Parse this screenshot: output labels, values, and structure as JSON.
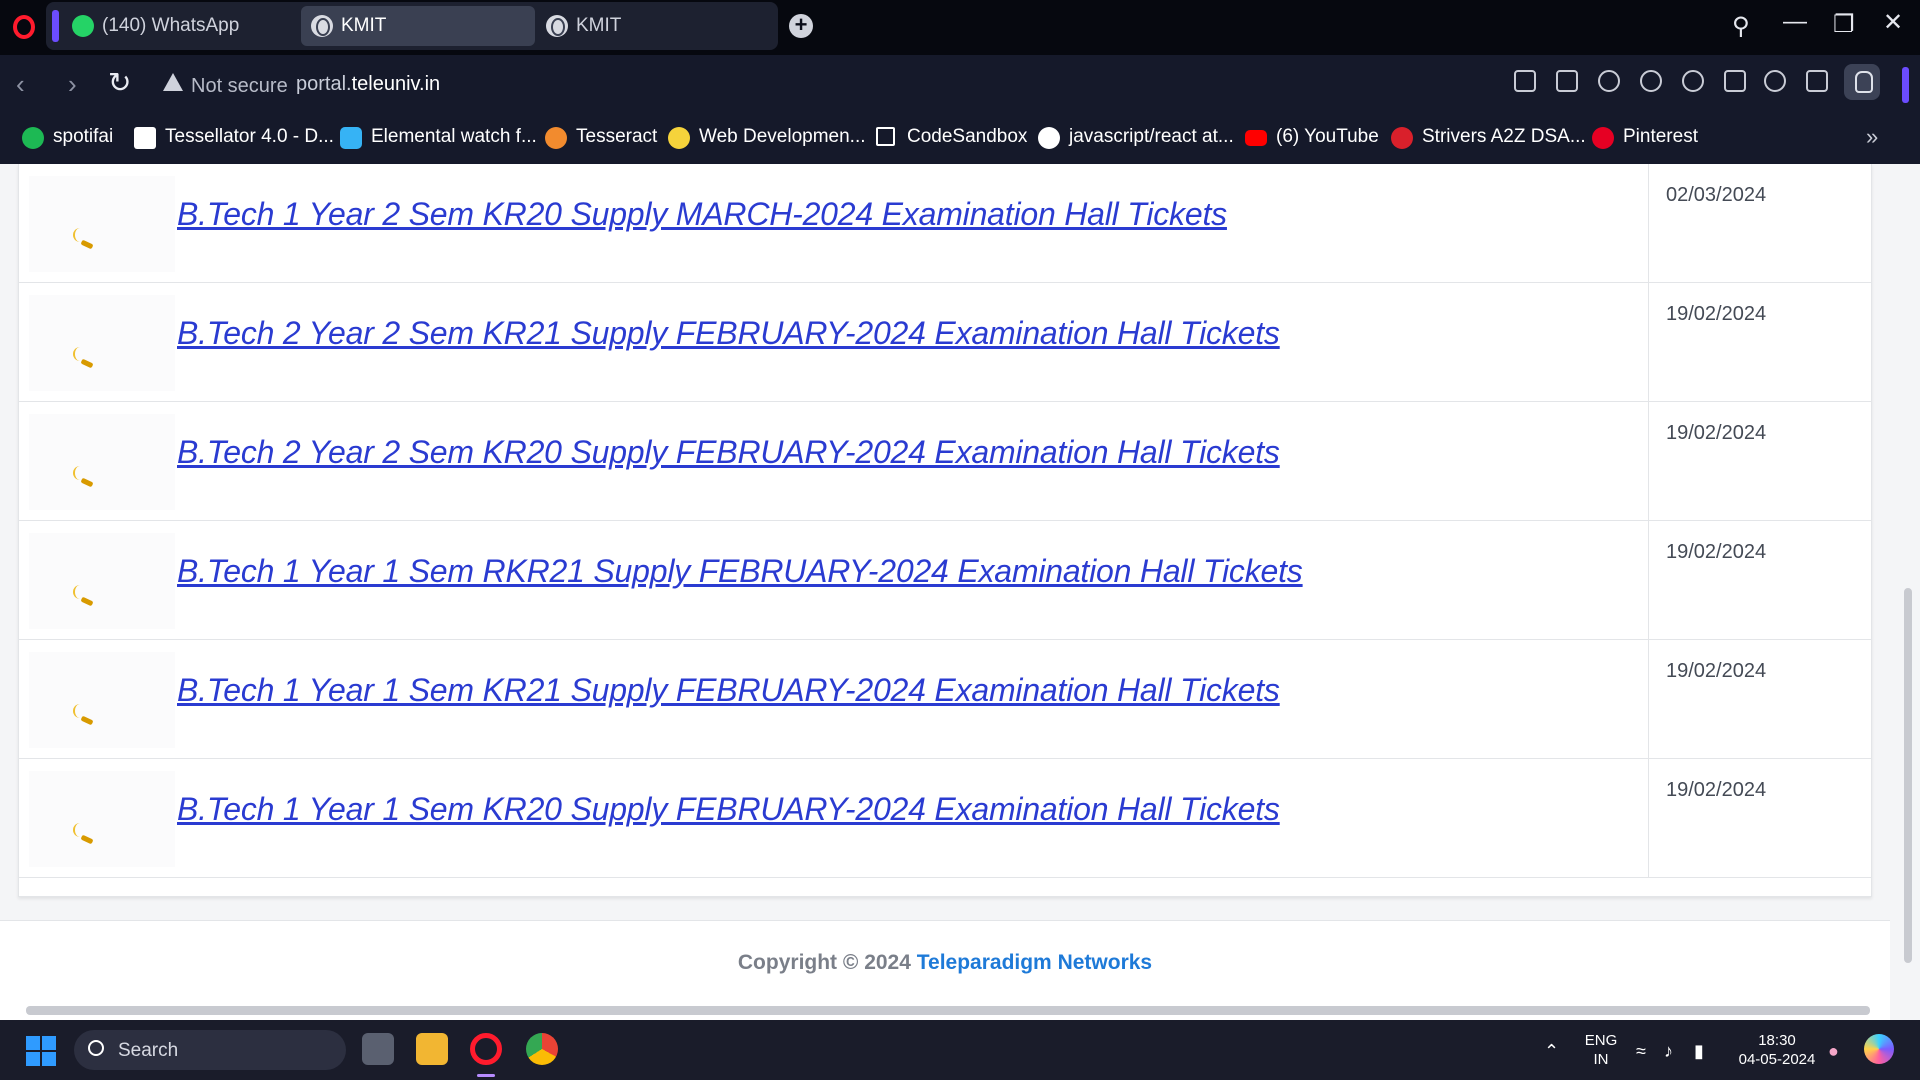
{
  "browser": {
    "tabs": [
      {
        "label": "(140) WhatsApp",
        "icon": "whatsapp-icon",
        "active": false
      },
      {
        "label": "KMIT",
        "icon": "globe-icon",
        "active": true
      },
      {
        "label": "KMIT",
        "icon": "globe-icon",
        "active": false
      }
    ],
    "security_label": "Not secure",
    "url_prefix": "portal.",
    "url_domain": "teleuniv.in",
    "bookmarks": [
      {
        "label": "spotifai",
        "icon": "spotify-icon",
        "color": "#1db954"
      },
      {
        "label": "Tessellator 4.0 - D...",
        "icon": "tessellator-icon",
        "color": "#ffffff"
      },
      {
        "label": "Elemental watch f...",
        "icon": "elemental-icon",
        "color": "#36b3f5"
      },
      {
        "label": "Tesseract",
        "icon": "tesseract-icon",
        "color": "#f28b2e"
      },
      {
        "label": "Web Developmen...",
        "icon": "web-dev-icon",
        "color": "#f5d33b"
      },
      {
        "label": "CodeSandbox",
        "icon": "codesandbox-icon",
        "color": "#ffffff"
      },
      {
        "label": "javascript/react at...",
        "icon": "github-icon",
        "color": "#ffffff"
      },
      {
        "label": "(6) YouTube",
        "icon": "youtube-icon",
        "color": "#ff0000"
      },
      {
        "label": "Strivers A2Z DSA...",
        "icon": "takeuforward-icon",
        "color": "#d9202b"
      },
      {
        "label": "Pinterest",
        "icon": "pinterest-icon",
        "color": "#e60023"
      }
    ]
  },
  "page": {
    "tickets": [
      {
        "title": "B.Tech 1 Year 2 Sem KR20 Supply MARCH-2024 Examination Hall Tickets",
        "date": "02/03/2024"
      },
      {
        "title": "B.Tech 2 Year 2 Sem KR21 Supply FEBRUARY-2024 Examination Hall Tickets",
        "date": "19/02/2024"
      },
      {
        "title": "B.Tech 2 Year 2 Sem KR20 Supply FEBRUARY-2024 Examination Hall Tickets",
        "date": "19/02/2024"
      },
      {
        "title": "B.Tech 1 Year 1 Sem RKR21 Supply FEBRUARY-2024 Examination Hall Tickets",
        "date": "19/02/2024"
      },
      {
        "title": "B.Tech 1 Year 1 Sem KR21 Supply FEBRUARY-2024 Examination Hall Tickets",
        "date": "19/02/2024"
      },
      {
        "title": "B.Tech 1 Year 1 Sem KR20 Supply FEBRUARY-2024 Examination Hall Tickets",
        "date": "19/02/2024"
      }
    ],
    "footer_prefix": "Copyright © 2024 ",
    "footer_company": "Teleparadigm Networks"
  },
  "taskbar": {
    "search_label": "Search",
    "apps": [
      "calculator-icon",
      "file-explorer-icon",
      "opera-icon",
      "chrome-icon"
    ],
    "lang_line1": "ENG",
    "lang_line2": "IN",
    "time": "18:30",
    "date": "04-05-2024"
  },
  "colors": {
    "link": "#2a3bd1",
    "footer_link": "#1e7ad8",
    "browser_accent": "#6b4cff",
    "opera_red": "#ff1b2d"
  }
}
